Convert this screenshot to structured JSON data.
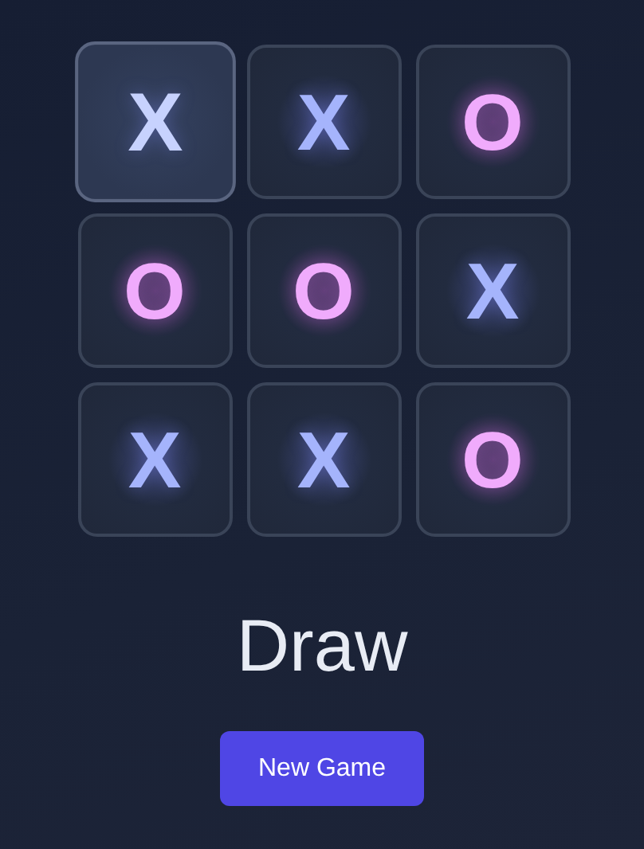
{
  "board": {
    "cells": [
      {
        "mark": "X",
        "kind": "x",
        "selected": true
      },
      {
        "mark": "X",
        "kind": "x",
        "selected": false
      },
      {
        "mark": "O",
        "kind": "o",
        "selected": false
      },
      {
        "mark": "O",
        "kind": "o",
        "selected": false
      },
      {
        "mark": "O",
        "kind": "o",
        "selected": false
      },
      {
        "mark": "X",
        "kind": "x",
        "selected": false
      },
      {
        "mark": "X",
        "kind": "x",
        "selected": false
      },
      {
        "mark": "X",
        "kind": "x",
        "selected": false
      },
      {
        "mark": "O",
        "kind": "o",
        "selected": false
      }
    ]
  },
  "status": "Draw",
  "buttons": [
    "New Game"
  ]
}
